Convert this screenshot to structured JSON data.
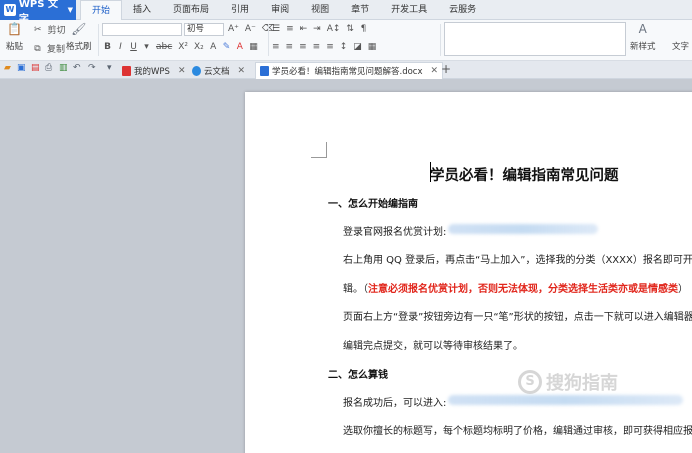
{
  "app": {
    "name": "WPS 文字",
    "logo": "W"
  },
  "menu": [
    "开始",
    "插入",
    "页面布局",
    "引用",
    "审阅",
    "视图",
    "章节",
    "开发工具",
    "云服务"
  ],
  "ribbon": {
    "paste": "粘贴",
    "cut": "剪切",
    "copy": "复制",
    "format_painter": "格式刷",
    "font_size": "初号",
    "new_style": "新样式",
    "text_tool": "文字"
  },
  "tabs": [
    {
      "label": "我的WPS",
      "icon": "wps-icon"
    },
    {
      "label": "云文档",
      "icon": "cloud-icon"
    },
    {
      "label": "学员必看！编辑指南常见问题解答.docx",
      "icon": "doc-icon"
    }
  ],
  "doc": {
    "title": "学员必看！编辑指南常见问题",
    "h1": "一、怎么开始编指南",
    "p1": "登录官网报名优赏计划:",
    "p2": "右上角用 QQ 登录后，再点击“马上加入”，选择我的分类（XXXX）报名即可开始",
    "p3_start": "辑。（",
    "p3_red": "注意必须报名优赏计划，否则无法体现，分类选择生活类亦或是情感类",
    "p3_end": "）",
    "p4": "页面右上方“登录”按钮旁边有一只“笔”形状的按钮，点击一下就可以进入编辑器",
    "p5": "编辑完点提交，就可以等待审核结果了。",
    "h2": "二、怎么算钱",
    "p6": "报名成功后，可以进入:",
    "p7": "选取你擅长的标题写，每个标题均标明了价格，编辑通过审核，即可获得相应报酬。"
  },
  "watermark": "搜狗指南",
  "colors": {
    "accent": "#2b6fd6",
    "red_text": "#e1251b"
  }
}
